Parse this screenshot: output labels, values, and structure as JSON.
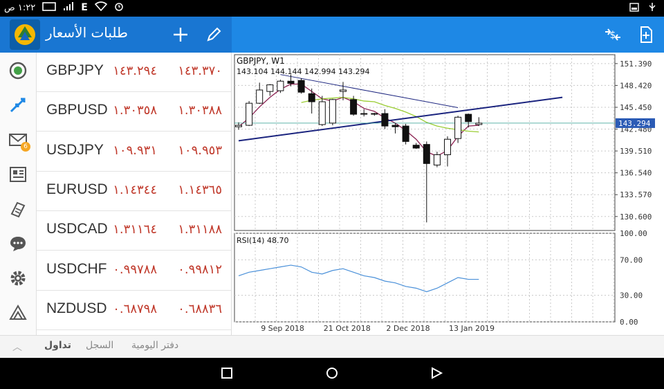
{
  "status_bar": {
    "time": "١:٢٢ ص",
    "network": "E",
    "icons": [
      "screenshot-icon",
      "signal-icon",
      "wifi-icon",
      "alarm-icon",
      "battery-icon",
      "image-icon",
      "usb-icon"
    ]
  },
  "app_bar": {
    "title": "طلبات الأسعار",
    "icons": [
      "metatrader-logo-icon",
      "plus-icon",
      "pencil-icon",
      "currency-swap-icon",
      "add-document-icon"
    ],
    "accent": "#1e88e5"
  },
  "sidebar": {
    "items": [
      {
        "icon": "quotes-icon"
      },
      {
        "icon": "trade-arrows-icon"
      },
      {
        "icon": "mail-icon",
        "badge": "6"
      },
      {
        "icon": "news-icon"
      },
      {
        "icon": "journal-icon"
      },
      {
        "icon": "chat-icon"
      },
      {
        "icon": "settings-icon"
      },
      {
        "icon": "metatrader-icon"
      }
    ]
  },
  "quotes": [
    {
      "symbol": "GBPJPY",
      "bid": "١٤٣.٢٩٤",
      "ask": "١٤٣.٣٧٠"
    },
    {
      "symbol": "GBPUSD",
      "bid": "١.٣٠٣٥٨",
      "ask": "١.٣٠٣٨٨"
    },
    {
      "symbol": "USDJPY",
      "bid": "١٠٩.٩٣١",
      "ask": "١٠٩.٩٥٣"
    },
    {
      "symbol": "EURUSD",
      "bid": "١.١٤٣٤٤",
      "ask": "١.١٤٣٦٥"
    },
    {
      "symbol": "USDCAD",
      "bid": "١.٣١١٦٤",
      "ask": "١.٣١١٨٨"
    },
    {
      "symbol": "USDCHF",
      "bid": "٠.٩٩٧٨٨",
      "ask": "٠.٩٩٨١٢"
    },
    {
      "symbol": "NZDUSD",
      "bid": "٠.٦٨٧٩٨",
      "ask": "٠.٦٨٨٣٦"
    }
  ],
  "chart": {
    "header": "GBPJPY, W1",
    "ohlc": "143.104 144.144 142.994 143.294",
    "current_price": "143.294",
    "rsi_label": "RSI(14) 48.70"
  },
  "chart_data": [
    {
      "type": "candlestick",
      "symbol": "GBPJPY",
      "timeframe": "W1",
      "y_ticks": [
        151.39,
        148.42,
        145.45,
        142.48,
        139.51,
        136.54,
        133.57,
        130.6
      ],
      "ylim": [
        128.7,
        152.6
      ],
      "x_ticks": [
        "9 Sep 2018",
        "21 Oct 2018",
        "2 Dec 2018",
        "13 Jan 2019"
      ],
      "last_price": 143.294,
      "candles": [
        {
          "o": 142.8,
          "h": 143.4,
          "l": 142.4,
          "c": 143.0
        },
        {
          "o": 143.0,
          "h": 146.3,
          "l": 142.9,
          "c": 146.0
        },
        {
          "o": 146.0,
          "h": 148.8,
          "l": 145.9,
          "c": 147.8
        },
        {
          "o": 147.6,
          "h": 148.6,
          "l": 147.0,
          "c": 148.5
        },
        {
          "o": 147.7,
          "h": 149.2,
          "l": 147.4,
          "c": 149.0
        },
        {
          "o": 149.0,
          "h": 149.9,
          "l": 148.3,
          "c": 148.7
        },
        {
          "o": 149.1,
          "h": 149.4,
          "l": 147.3,
          "c": 147.5
        },
        {
          "o": 147.3,
          "h": 148.0,
          "l": 144.6,
          "c": 146.2
        },
        {
          "o": 143.1,
          "h": 147.0,
          "l": 142.9,
          "c": 146.2
        },
        {
          "o": 143.3,
          "h": 146.6,
          "l": 143.0,
          "c": 146.5
        },
        {
          "o": 147.6,
          "h": 148.9,
          "l": 146.4,
          "c": 147.8
        },
        {
          "o": 146.5,
          "h": 147.0,
          "l": 144.3,
          "c": 144.5
        },
        {
          "o": 144.6,
          "h": 145.2,
          "l": 144.2,
          "c": 144.6
        },
        {
          "o": 144.6,
          "h": 144.7,
          "l": 144.3,
          "c": 144.6
        },
        {
          "o": 144.6,
          "h": 145.2,
          "l": 142.5,
          "c": 142.9
        },
        {
          "o": 143.0,
          "h": 143.3,
          "l": 141.9,
          "c": 142.8
        },
        {
          "o": 142.9,
          "h": 143.2,
          "l": 140.4,
          "c": 140.8
        },
        {
          "o": 140.3,
          "h": 140.6,
          "l": 139.8,
          "c": 139.9
        },
        {
          "o": 140.4,
          "h": 140.8,
          "l": 129.8,
          "c": 137.8
        },
        {
          "o": 137.6,
          "h": 139.4,
          "l": 137.3,
          "c": 139.0
        },
        {
          "o": 139.0,
          "h": 141.5,
          "l": 137.4,
          "c": 141.1
        },
        {
          "o": 141.2,
          "h": 144.3,
          "l": 140.6,
          "c": 144.1
        },
        {
          "o": 144.5,
          "h": 144.6,
          "l": 142.7,
          "c": 143.5
        },
        {
          "o": 143.1,
          "h": 144.1,
          "l": 142.9,
          "c": 143.3
        }
      ],
      "series": [
        {
          "values": [
            142.8,
            144.0,
            145.5,
            146.8,
            147.9,
            148.6,
            148.6,
            147.6,
            146.6,
            146.3,
            146.8,
            146.2,
            145.3,
            144.9,
            144.0,
            143.3,
            142.3,
            141.1,
            139.4,
            138.8,
            139.6,
            141.5,
            142.9,
            143.0
          ]
        },
        {
          "values": [
            null,
            null,
            null,
            null,
            null,
            null,
            146.1,
            146.4,
            146.6,
            146.7,
            146.8,
            146.6,
            146.3,
            146.2,
            145.7,
            145.3,
            144.8,
            144.2,
            143.4,
            142.9,
            142.6,
            142.4,
            142.2,
            142.1
          ]
        }
      ],
      "trendlines": [
        {
          "from": {
            "i": 4,
            "v": 149.9
          },
          "to": {
            "i": 21,
            "v": 145.4
          }
        },
        {
          "from": {
            "i": 0,
            "v": 140.9
          },
          "to": {
            "i": 31,
            "v": 146.8
          }
        }
      ]
    },
    {
      "type": "line",
      "title": "RSI(14) 48.70",
      "y_ticks": [
        100.0,
        70.0,
        30.0,
        0.0
      ],
      "ylim": [
        0,
        100
      ],
      "values": [
        52,
        56,
        58,
        60,
        62,
        64,
        62,
        56,
        54,
        58,
        60,
        56,
        52,
        50,
        46,
        44,
        40,
        38,
        34,
        38,
        44,
        50,
        48,
        48
      ]
    }
  ],
  "colors": {
    "bid_ask": "#c0392b",
    "ma_fast": "#8b2252",
    "ma_slow": "#9acd32",
    "trendline": "#1a237e",
    "rsi": "#4a90d9",
    "price_line": "#2a9d8f"
  },
  "bottom_tabs": {
    "items": [
      {
        "label": "تداول",
        "active": true
      },
      {
        "label": "السجل",
        "active": false
      },
      {
        "label": "دفتر اليومية",
        "active": false
      }
    ]
  },
  "nav_bar": {
    "icons": [
      "recents-square-icon",
      "home-circle-icon",
      "back-triangle-icon"
    ]
  }
}
